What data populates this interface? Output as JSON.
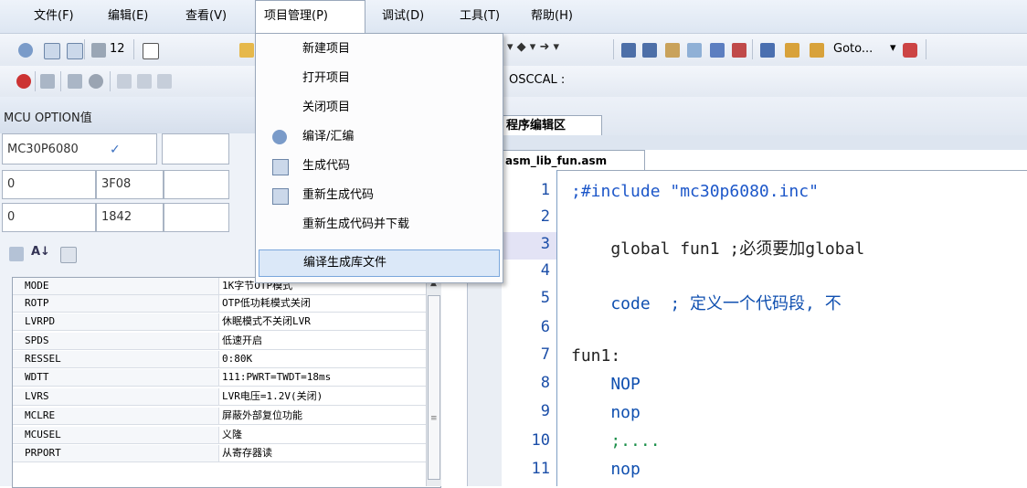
{
  "menubar": {
    "items": [
      "文件(F)",
      "编辑(E)",
      "查看(V)",
      "项目管理(P)",
      "调试(D)",
      "工具(T)",
      "帮助(H)"
    ]
  },
  "toolbar": {
    "num": "12",
    "goto": "Goto...",
    "osccal": "OSCCAL :"
  },
  "left_panel": {
    "title": "MCU OPTION值",
    "chip": "MC30P6080",
    "rows": [
      {
        "a": "0",
        "b": "3F08"
      },
      {
        "a": "0",
        "b": "1842"
      }
    ]
  },
  "props": [
    {
      "k": "MODE",
      "v": "1K字节OTP模式"
    },
    {
      "k": "ROTP",
      "v": "OTP低功耗模式关闭"
    },
    {
      "k": "LVRPD",
      "v": "休眠模式不关闭LVR"
    },
    {
      "k": "SPDS",
      "v": "低速开启"
    },
    {
      "k": "RESSEL",
      "v": "0:80K"
    },
    {
      "k": "WDTT",
      "v": "111:PWRT=TWDT=18ms"
    },
    {
      "k": "LVRS",
      "v": "LVR电压=1.2V(关闭)"
    },
    {
      "k": "MCLRE",
      "v": "屏蔽外部复位功能"
    },
    {
      "k": "MCUSEL",
      "v": "义隆"
    },
    {
      "k": "PRPORT",
      "v": "从寄存器读"
    }
  ],
  "project_menu": {
    "items": [
      "新建项目",
      "打开项目",
      "关闭项目",
      "编译/汇编",
      "生成代码",
      "重新生成代码",
      "重新生成代码并下载",
      "编译生成库文件"
    ]
  },
  "editor": {
    "pane_tab": "程序编辑区",
    "file_tab": "asm_lib_fun.asm",
    "lines": [
      {
        "n": "1",
        "t": ";#include \"mc30p6080.inc\""
      },
      {
        "n": "2",
        "t": ""
      },
      {
        "n": "3",
        "t": "    global fun1 ;必须要加global"
      },
      {
        "n": "4",
        "t": ""
      },
      {
        "n": "5",
        "t": "    code  ; 定义一个代码段, 不"
      },
      {
        "n": "6",
        "t": ""
      },
      {
        "n": "7",
        "t": "fun1:"
      },
      {
        "n": "8",
        "t": "    NOP"
      },
      {
        "n": "9",
        "t": "    nop"
      },
      {
        "n": "10",
        "t": "    ;...."
      },
      {
        "n": "11",
        "t": "    nop"
      }
    ]
  },
  "colors": {
    "accent": "#1d57c9",
    "highlight": "#dbe8f8",
    "comment": "#1b8f4a"
  }
}
